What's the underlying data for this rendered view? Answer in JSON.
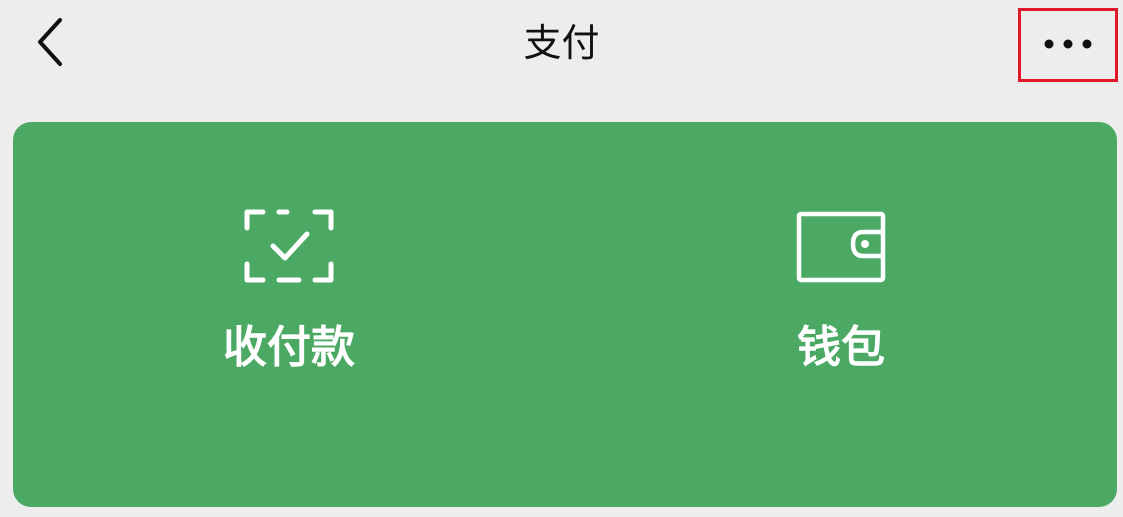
{
  "header": {
    "title": "支付",
    "back_icon": "chevron-left-icon",
    "more_icon": "more-horizontal-icon",
    "highlight_color": "#E0182A"
  },
  "card": {
    "background_color": "#4CA964",
    "actions": [
      {
        "label": "收付款",
        "icon": "scan-check-icon"
      },
      {
        "label": "钱包",
        "icon": "wallet-icon"
      }
    ]
  }
}
